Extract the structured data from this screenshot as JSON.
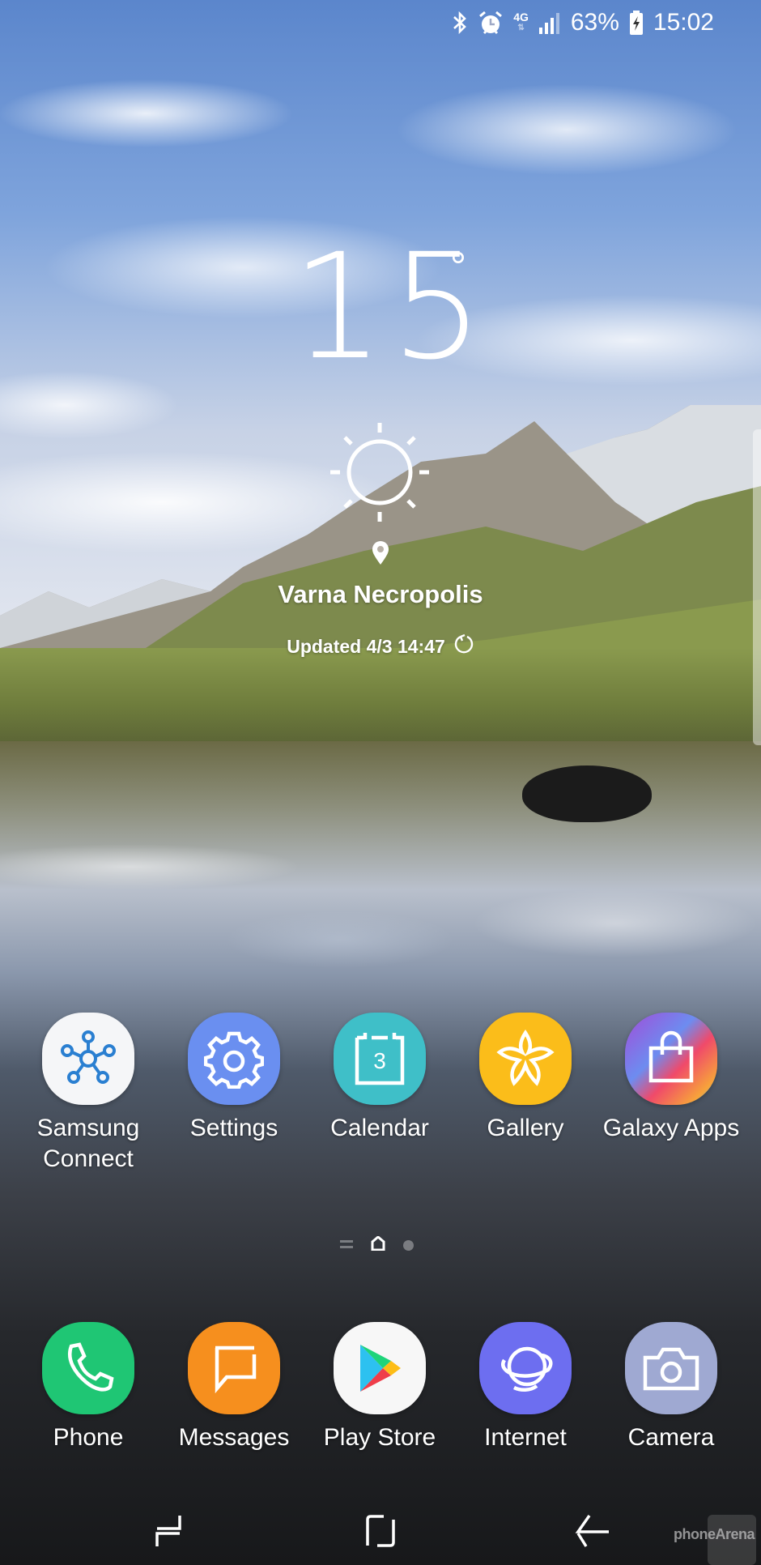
{
  "status_bar": {
    "icons": [
      "bluetooth-icon",
      "alarm-icon",
      "network-4g-icon",
      "signal-icon",
      "battery-charging-icon"
    ],
    "network_label": "4G",
    "battery": "63%",
    "time": "15:02"
  },
  "weather": {
    "temperature": "15",
    "degree": "°",
    "condition_icon": "sunny-icon",
    "location": "Varna Necropolis",
    "updated": "Updated 4/3 14:47"
  },
  "apps": [
    {
      "label": "Samsung Connect",
      "icon": "samsung-connect-icon",
      "bg": "#f5f6f8"
    },
    {
      "label": "Settings",
      "icon": "settings-gear-icon",
      "bg": "#6a8ff0"
    },
    {
      "label": "Calendar",
      "icon": "calendar-icon",
      "bg": "#3fbfc8",
      "day": "3"
    },
    {
      "label": "Gallery",
      "icon": "gallery-flower-icon",
      "bg": "#fbbd1a"
    },
    {
      "label": "Galaxy Apps",
      "icon": "galaxy-apps-bag-icon",
      "bg": "#b0569a"
    }
  ],
  "dock": [
    {
      "label": "Phone",
      "icon": "phone-icon",
      "bg": "#1fc674"
    },
    {
      "label": "Messages",
      "icon": "messages-icon",
      "bg": "#f68f1e"
    },
    {
      "label": "Play Store",
      "icon": "play-store-icon",
      "bg": "#f7f7f7"
    },
    {
      "label": "Internet",
      "icon": "internet-planet-icon",
      "bg": "#6d6ef0"
    },
    {
      "label": "Camera",
      "icon": "camera-icon",
      "bg": "#9fa9d2"
    }
  ],
  "page_indicator": {
    "pages": 3,
    "current": "home"
  },
  "navigation": [
    "recents",
    "home",
    "back"
  ],
  "watermark": "phoneArena"
}
